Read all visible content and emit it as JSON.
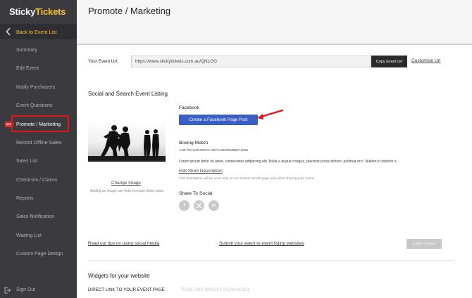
{
  "app": {
    "logo_part1": "Sticky",
    "logo_part2": "Tickets",
    "accent_color": "#f7c32e"
  },
  "sidebar": {
    "back_label": "Back to Event List",
    "items": [
      {
        "label": "Summary"
      },
      {
        "label": "Edit Event"
      },
      {
        "label": "Notify Purchasers"
      },
      {
        "label": "Event Questions"
      },
      {
        "label": "Promote / Marketing",
        "active": true,
        "badge": "NEW"
      },
      {
        "label": "Record Offline Sales"
      },
      {
        "label": "Sales List"
      },
      {
        "label": "Check-ins / Claims"
      },
      {
        "label": "Reports"
      },
      {
        "label": "Sales Notification"
      },
      {
        "label": "Waiting List"
      },
      {
        "label": "Custom Page Design"
      }
    ],
    "signout_label": "Sign Out"
  },
  "header": {
    "title": "Promote / Marketing"
  },
  "event_url": {
    "label": "Your Event Url:",
    "value": "https://www.stickytickets.com.au/QNLGG",
    "copy_label": "Copy Event Url",
    "customise_label": "Customise Url"
  },
  "listing": {
    "section_title": "Social and Search Event Listing",
    "change_image_label": "Change Image",
    "image_hint": "Adding an image can help increase ticket sales",
    "facebook_label": "Facebook",
    "facebook_button": "Create a Facebook Page Post",
    "event_name": "Boxing Match",
    "event_date": "1:00 PM SATURDAY 26TH DECEMBER 2026",
    "event_description": "Lorem ipsum dolor sit amet, consectetur adipiscing elit. Nulla a augue congue, placerat purus dictum, pulvinar orci. Nullam in lobortis o...",
    "edit_description_label": "Edit Short Description",
    "description_hint": "This description will be used only on our search results page and when sharing your event",
    "share_title": "Share To Social",
    "social_icons": [
      "facebook-icon",
      "x-icon",
      "linkedin-icon"
    ]
  },
  "links": {
    "tips_label": "Read our tips on using social media",
    "submit_label": "Submit your event to event listing websites",
    "email_friend_label": "Email A Friend"
  },
  "widgets": {
    "title": "Widgets for your website",
    "tab_direct": "DIRECT LINK TO YOUR EVENT PAGE",
    "tab_widget": "TICKETING WIDGET (ADVANCED)"
  }
}
